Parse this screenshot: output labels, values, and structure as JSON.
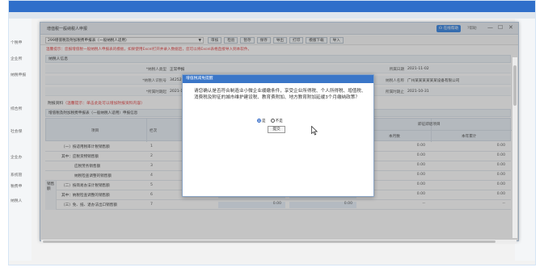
{
  "background": {
    "left_items": [
      "个税申",
      "企业所",
      "纳税申报",
      "综合所",
      "社会保",
      "企业办",
      "系统管",
      "税费申",
      "纳税人"
    ]
  },
  "window": {
    "title": "增值税一般纳税人申报",
    "online_button": "在线帮助",
    "help": "帮助",
    "minimize": "—",
    "maximize": "☐",
    "close": "✕"
  },
  "toolbar": {
    "period": "299增值税及附加税费申报表（一般纳税人适用）",
    "buttons": [
      "审核",
      "检验",
      "暂存",
      "保存",
      "导出",
      "打印",
      "模版下载",
      "导入"
    ]
  },
  "tip": "温馨提示：您报增值税一般纳税人申报表的模板，如果使用Excel打开并录入数据后，您可以将Excel表格直接导入到本软件。",
  "taxpayer": {
    "section_title": "纳税人信息",
    "rows": [
      {
        "label": "*纳税人类型",
        "value": "正常申报",
        "label2": "所属日期",
        "value2": "2021-11-02"
      },
      {
        "label": "*纳税人识别号",
        "value": "342523(",
        "label2": "纳税人名称",
        "value2": "广州某某某某某某设备有限公司"
      },
      {
        "label": "*所属时期起",
        "value": "2021-10-",
        "label2": "所属时期止",
        "value2": "2021-10-31"
      }
    ]
  },
  "attachment": {
    "label": "附报资料",
    "hint": "（温馨提示：单击此处可以增加附报资料内容）"
  },
  "table": {
    "title": "增值税及附加税费申报表（一般纳税人适用）申报信息",
    "headers": {
      "item": "项目",
      "col": "栏次",
      "group": "即征即退项目",
      "month": "本月数",
      "year": "本年累计"
    },
    "rows": [
      {
        "name": "（一）按适用税率计税销售额",
        "idx": "1",
        "v1": "",
        "v2": "",
        "v3": "0.00",
        "v4": "0.00"
      },
      {
        "name": "其中：应税货物销售额",
        "idx": "2",
        "v1": "",
        "v2": "",
        "v3": "0.00",
        "v4": "0.00"
      },
      {
        "name": "应税劳务销售额",
        "idx": "3",
        "v1": "",
        "v2": "",
        "v3": "0.00",
        "v4": "0.00"
      },
      {
        "name": "纳税检查调整的销售额",
        "idx": "4",
        "v1": "",
        "v2": "",
        "v3": "0.00",
        "v4": "0.00"
      },
      {
        "name": "（二）按简易办法计税销售额",
        "idx": "5",
        "v1": "0.00",
        "v2": "0.00",
        "v3": "0.00",
        "v4": "0.00"
      },
      {
        "name": "其中：纳税检查调整的销售额",
        "idx": "6",
        "v1": "0.00",
        "v2": "0.00",
        "v3": "0.00",
        "v4": "0.00"
      },
      {
        "name": "（三）免、抵、退办法出口销售额",
        "idx": "7",
        "v1": "0.00",
        "v2": "0.00",
        "v3": "--",
        "v4": "--"
      }
    ],
    "side_label": "销售额"
  },
  "dialog": {
    "title": "增值税减免提醒",
    "text": "请您确认是否符合制造业小微企业缓缴条件，享受企业所得税、个人所得税、增值税、消费税及附征的城市维护建设税、教育费附加、地方教育附加延缓3个月缴纳政策？",
    "option_yes": "是",
    "option_no": "不是",
    "submit": "提交"
  }
}
